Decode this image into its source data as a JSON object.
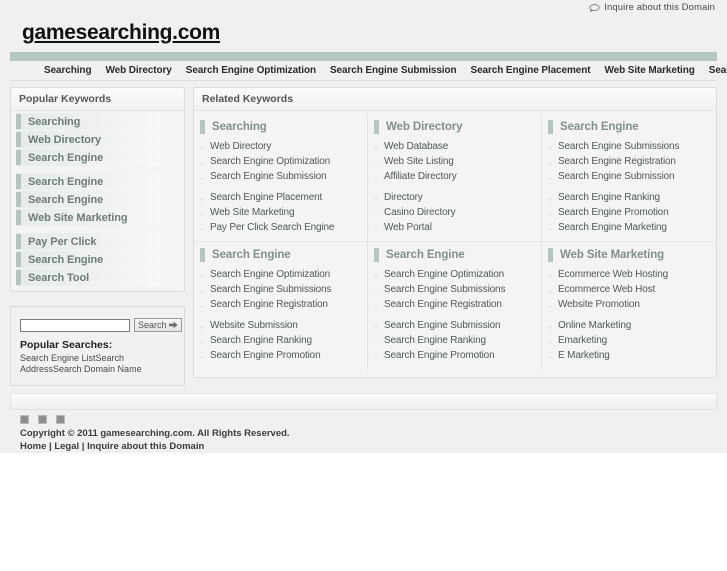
{
  "topbar": {
    "inquire_label": "Inquire about this Domain",
    "bubble_icon": "speech-bubble-icon"
  },
  "logo": {
    "text": "gamesearching.com"
  },
  "nav": {
    "items": [
      "Searching",
      "Web Directory",
      "Search Engine Optimization",
      "Search Engine Submission",
      "Search Engine Placement",
      "Web Site Marketing",
      "Search Tool"
    ]
  },
  "sidebar": {
    "title": "Popular Keywords",
    "groups": [
      {
        "items": [
          "Searching",
          "Web Directory",
          "Search Engine"
        ]
      },
      {
        "items": [
          "Search Engine",
          "Search Engine",
          "Web Site Marketing"
        ]
      },
      {
        "items": [
          "Pay Per Click",
          "Search Engine",
          "Search Tool"
        ]
      }
    ],
    "search": {
      "value": "",
      "placeholder": "",
      "button_label": "Search",
      "arrow_icon": "right-arrow-icon",
      "popular_title": "Popular Searches:",
      "popular_links": [
        "Search Engine List",
        "Search Address",
        "Search Domain Name"
      ]
    }
  },
  "main": {
    "title": "Related Keywords",
    "columns": [
      {
        "heading": "Searching",
        "groups": [
          [
            "Web Directory",
            "Search Engine Optimization",
            "Search Engine Submission"
          ],
          [
            "Search Engine Placement",
            "Web Site Marketing",
            "Pay Per Click Search Engine"
          ]
        ]
      },
      {
        "heading": "Web Directory",
        "groups": [
          [
            "Web Database",
            "Web Site Listing",
            "Affiliate Directory"
          ],
          [
            "Directory",
            "Casino Directory",
            "Web Portal"
          ]
        ]
      },
      {
        "heading": "Search Engine",
        "groups": [
          [
            "Search Engine Submissions",
            "Search Engine Registration",
            "Search Engine Submission"
          ],
          [
            "Search Engine Ranking",
            "Search Engine Promotion",
            "Search Engine Marketing"
          ]
        ]
      },
      {
        "heading": "Search Engine",
        "groups": [
          [
            "Search Engine Optimization",
            "Search Engine Submissions",
            "Search Engine Registration"
          ],
          [
            "Website Submission",
            "Search Engine Ranking",
            "Search Engine Promotion"
          ]
        ]
      },
      {
        "heading": "Search Engine",
        "groups": [
          [
            "Search Engine Optimization",
            "Search Engine Submissions",
            "Search Engine Registration"
          ],
          [
            "Search Engine Submission",
            "Search Engine Ranking",
            "Search Engine Promotion"
          ]
        ]
      },
      {
        "heading": "Web Site Marketing",
        "groups": [
          [
            "Ecommerce Web Hosting",
            "Ecommerce Web Host",
            "Website Promotion"
          ],
          [
            "Online Marketing",
            "Emarketing",
            "E Marketing"
          ]
        ]
      }
    ]
  },
  "footer": {
    "social_icons": [
      "social-square-icon",
      "social-square-icon",
      "social-square-icon"
    ],
    "copyright": "Copyright © 2011 gamesearching.com. All Rights Reserved.",
    "links": [
      "Home",
      "Legal",
      "Inquire about this Domain"
    ],
    "separator": " | "
  },
  "colors": {
    "accent": "#b4c5c4",
    "page_bg": "#f0f0f0",
    "heading_text": "#808f8f",
    "link_text": "#4e5a5a"
  }
}
